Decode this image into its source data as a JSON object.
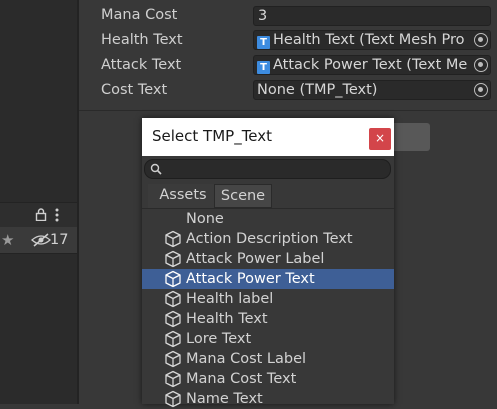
{
  "inspector": {
    "rows": [
      {
        "label": "Mana Cost",
        "value": "3"
      },
      {
        "label": "Health Text",
        "value": "Health Text (Text Mesh Pro"
      },
      {
        "label": "Attack Text",
        "value": "Attack Power Text (Text Me"
      },
      {
        "label": "Cost Text",
        "value": "None (TMP_Text)"
      }
    ]
  },
  "hierarchy_toolbar": {
    "lock_icon": "lock-icon",
    "menu_icon": "kebab-menu-icon",
    "star_icon": "star-icon",
    "visibility_count": "17"
  },
  "popup": {
    "title": "Select TMP_Text",
    "close_label": "×",
    "search_placeholder": "",
    "tabs": [
      "Assets",
      "Scene"
    ],
    "active_tab": "Scene",
    "items": [
      {
        "label": "None",
        "icon": "none"
      },
      {
        "label": "Action Description Text",
        "icon": "gameobject-cube-icon"
      },
      {
        "label": "Attack Power Label",
        "icon": "gameobject-cube-icon"
      },
      {
        "label": "Attack Power Text",
        "icon": "gameobject-cube-icon",
        "selected": true
      },
      {
        "label": "Health label",
        "icon": "gameobject-cube-icon"
      },
      {
        "label": "Health Text",
        "icon": "gameobject-cube-icon"
      },
      {
        "label": "Lore Text",
        "icon": "gameobject-cube-icon"
      },
      {
        "label": "Mana Cost Label",
        "icon": "gameobject-cube-icon"
      },
      {
        "label": "Mana Cost Text",
        "icon": "gameobject-cube-icon"
      },
      {
        "label": "Name Text",
        "icon": "gameobject-cube-icon"
      }
    ]
  },
  "colors": {
    "selection": "#3e5f96",
    "close_button": "#d3454a",
    "tmp_icon": "#3d8ce0"
  }
}
